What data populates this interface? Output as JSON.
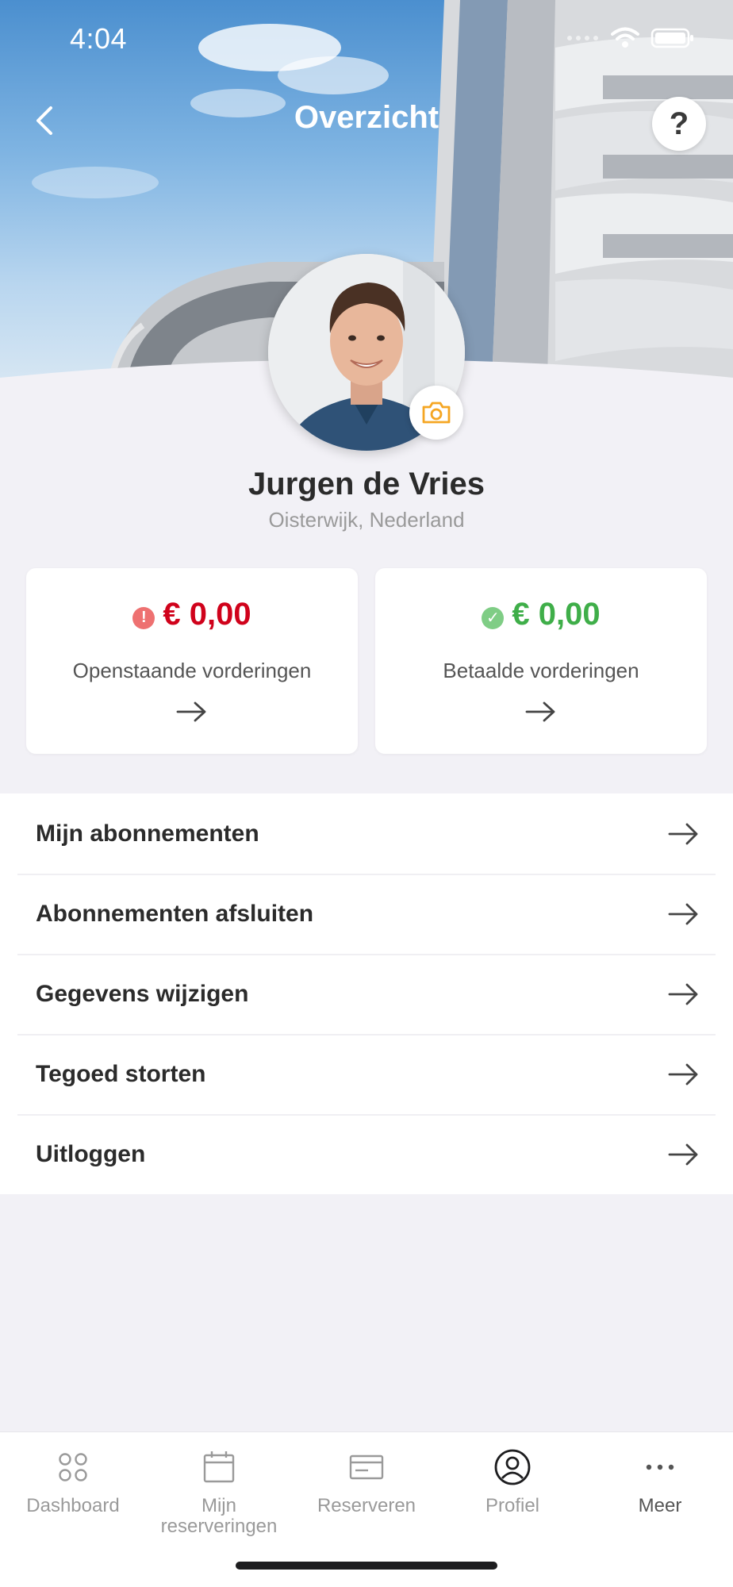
{
  "status_bar": {
    "time": "4:04"
  },
  "header": {
    "title": "Overzicht",
    "help_label": "?"
  },
  "profile": {
    "name": "Jurgen de Vries",
    "location": "Oisterwijk, Nederland"
  },
  "cards": {
    "open": {
      "amount": "€ 0,00",
      "label": "Openstaande vorderingen",
      "status_symbol": "!",
      "color": "#d0021b",
      "dot_color": "#ee7171"
    },
    "paid": {
      "amount": "€ 0,00",
      "label": "Betaalde vorderingen",
      "status_symbol": "✓",
      "color": "#3fae49",
      "dot_color": "#7fcd85"
    }
  },
  "menu": {
    "items": [
      {
        "label": "Mijn abonnementen"
      },
      {
        "label": "Abonnementen afsluiten"
      },
      {
        "label": "Gegevens wijzigen"
      },
      {
        "label": "Tegoed storten"
      },
      {
        "label": "Uitloggen"
      }
    ]
  },
  "tabbar": {
    "tabs": [
      {
        "label": "Dashboard",
        "icon": "grid-icon"
      },
      {
        "label": "Mijn reserveringen",
        "line1": "Mijn",
        "line2": "reserveringen",
        "icon": "calendar-icon"
      },
      {
        "label": "Reserveren",
        "icon": "card-icon"
      },
      {
        "label": "Profiel",
        "icon": "profile-icon",
        "active": true
      },
      {
        "label": "Meer",
        "icon": "more-icon"
      }
    ]
  },
  "colors": {
    "accent_camera": "#f5a623",
    "background": "#f2f1f6"
  }
}
